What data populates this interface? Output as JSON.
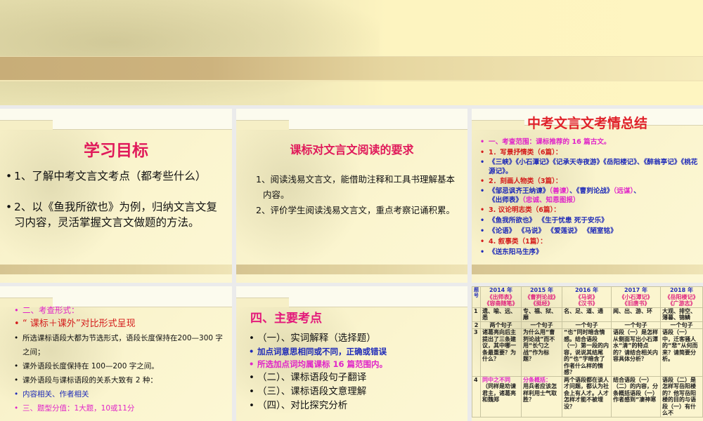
{
  "slides": [
    {
      "title": "学习目标",
      "items": [
        "1、了解中考文言文考点（都考些什么）",
        "2、以《鱼我所欲也》为例，归纳文言文复习内容，灵活掌握文言文做题的方法。"
      ]
    },
    {
      "title": "课标对文言文阅读的要求",
      "items": [
        "1、阅读浅易文言文，能借助注释和工具书理解基本内容。",
        "2、评价学生阅读浅易文言文，重点考察记诵积累。"
      ]
    },
    {
      "title": "中考文言文考情总结",
      "lines": [
        "一、考查范围：课标推荐的 16 篇古文。",
        "1．写景抒情类（6篇）：",
        "《三峡》《小石潭记》《记承天寺夜游》《岳阳楼记》、《醉翁亭记》《桃花源记》。",
        "2．刻画人物类（3篇）：",
        "《邹忌讽齐王纳谏》",
        "（善谏）",
        "、《曹刿论战》",
        "（远谋）",
        "、",
        "《出师表》",
        "（忠诚、知恩图报）",
        "3. 议论明志类（6篇）：",
        "《鱼我所欲也》 《生于忧患 死于安乐》",
        "《论语》 《马说》 《爱莲说》 《陋室铭》",
        "4. 叙事类（1篇）：",
        "《送东阳马生序》"
      ]
    },
    {
      "lines": [
        "二、考查形式：",
        "“ 课标＋课外”对比形式呈现",
        "所选课标语段大都为节选形式，语段长度保持在200—300 字之间；",
        "课外语段长度保持在 100—200 字之间。",
        "课外语段与课标语段的关系大致有 2 种：",
        "内容相关、作者相关",
        "三、题型分值：1大题，10或11分"
      ]
    },
    {
      "title": "四、主要考点",
      "lines": [
        "（一）、实词解释（选择题）",
        "加点词意思相同或不同，正确或错误",
        "所选加点词均属课标 16 篇范围内。",
        "（二）、课标语段句子翻译",
        "（三）、课标语段文意理解",
        "（四）、对比探究分析"
      ]
    },
    {
      "table": {
        "corner": "题号",
        "years": [
          {
            "year": "2014 年",
            "books": [
              "《出师表》",
              "《容斋随笔》"
            ]
          },
          {
            "year": "2015 年",
            "books": [
              "《曹刿论战》",
              "《挺经》"
            ]
          },
          {
            "year": "2016 年",
            "books": [
              "《马说》",
              "《汉书》"
            ]
          },
          {
            "year": "2017 年",
            "books": [
              "《小石潭记》",
              "《旧唐书》"
            ]
          },
          {
            "year": "2018 年",
            "books": [
              "《岳阳楼记》",
              "《广游志》"
            ]
          }
        ],
        "rows": [
          {
            "no": "1",
            "cells": [
              "遗、喻、远、悉",
              "专、福、狱、靡",
              "名、足、道、通",
              "闻、出、游、环",
              "大观、排空、薄暮、锦鳞"
            ]
          },
          {
            "no": "2",
            "cells": [
              "两个句子",
              "一个句子",
              "一个句子",
              "一个句子",
              "一个句子"
            ]
          },
          {
            "no": "3",
            "cells": [
              "诸葛亮向后主提出了三条建议，其中哪一条最重要？为什么？",
              "为什么用“曹刿论战”而不用“长勺之战”作为标题？",
              "“也”同时暗含情感。结合语段（一）第一段的内容，说说其结尾的“也”字暗含了作者什么样的情感？",
              "语段（一）是怎样从侧面写出小石潭水“清”的特点的？请结合相关内容具体分析？",
              "语段（一）中，迁客骚人的“悲”从何而来？请简要分析。"
            ]
          },
          {
            "no": "4",
            "hl": [
              "同中之不同",
              "分条概括："
            ],
            "cells": [
              "（同样是劝谏君主，诸葛亮和魏郑",
              "用兵者应该怎样利用士气取胜？",
              "两个语段都在谈人才问题，都认为社会上有人才。人才怎样才能不被埋没？",
              "结合语段（一）（二）的内容，分条概括语段（一）作者感到“凄神寒",
              "语段（二）是怎样写岳阳楼的？他写岳阳楼的目的与语段（一）有什么不"
            ]
          }
        ]
      }
    }
  ]
}
